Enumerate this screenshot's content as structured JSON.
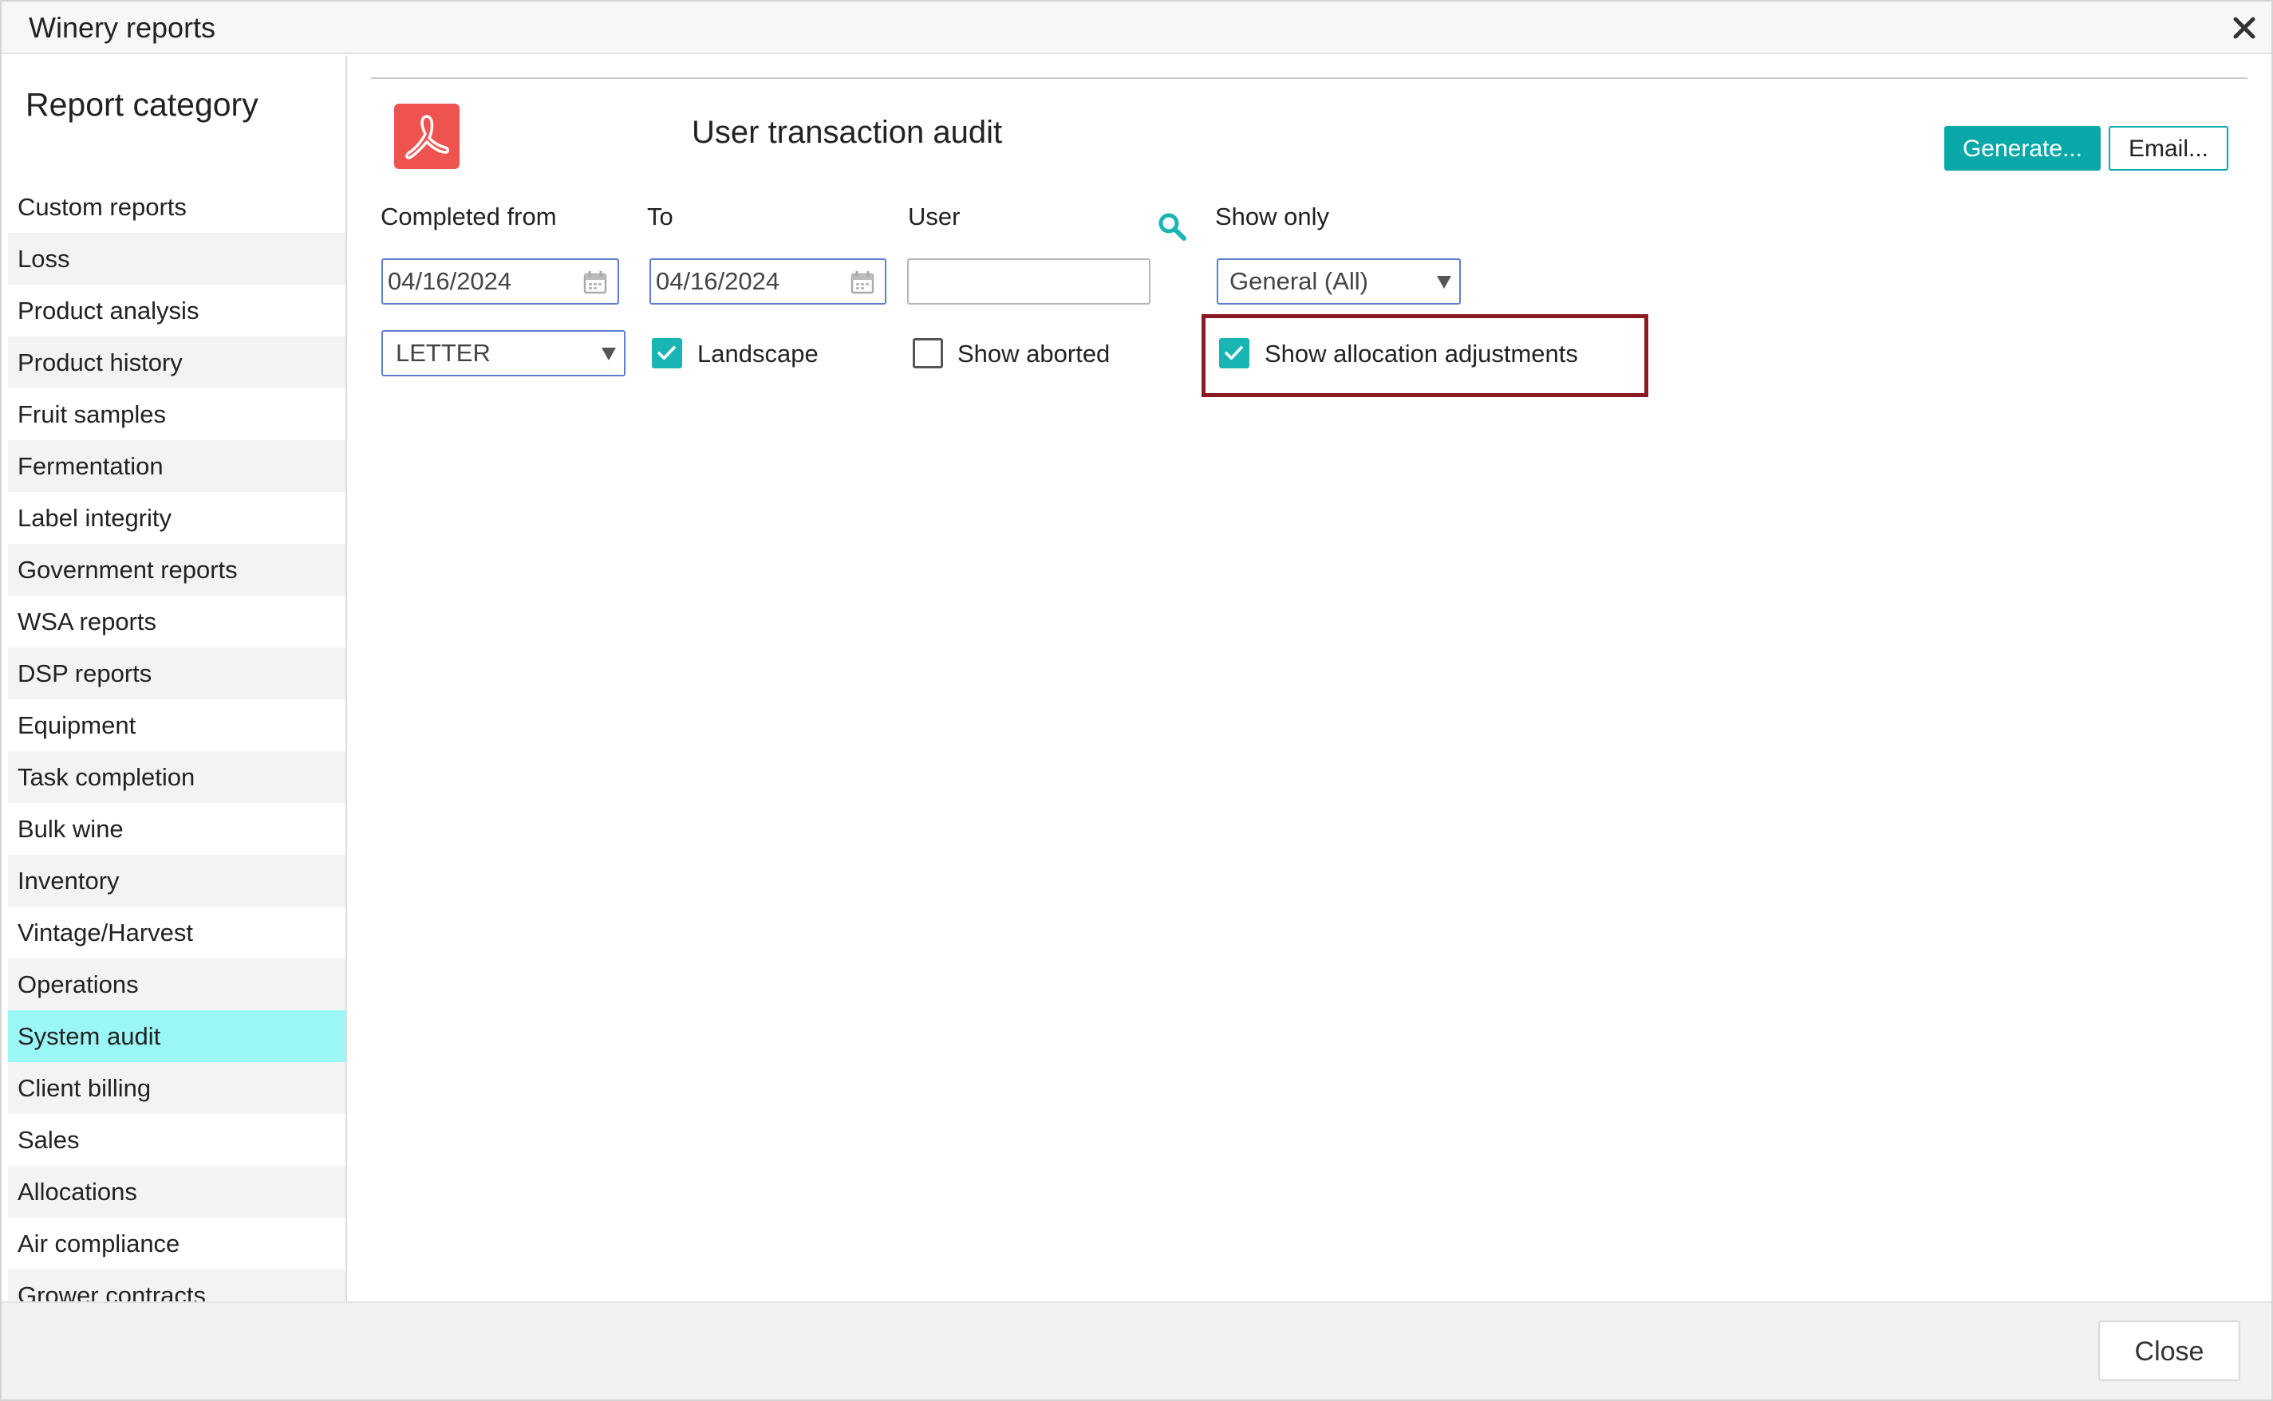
{
  "window": {
    "title": "Winery reports"
  },
  "sidebar": {
    "heading": "Report category",
    "items": [
      {
        "label": "Custom reports"
      },
      {
        "label": "Loss"
      },
      {
        "label": "Product analysis"
      },
      {
        "label": "Product history"
      },
      {
        "label": "Fruit samples"
      },
      {
        "label": "Fermentation"
      },
      {
        "label": "Label integrity"
      },
      {
        "label": "Government reports"
      },
      {
        "label": "WSA reports"
      },
      {
        "label": "DSP reports"
      },
      {
        "label": "Equipment"
      },
      {
        "label": "Task completion"
      },
      {
        "label": "Bulk wine"
      },
      {
        "label": "Inventory"
      },
      {
        "label": "Vintage/Harvest"
      },
      {
        "label": "Operations"
      },
      {
        "label": "System audit"
      },
      {
        "label": "Client billing"
      },
      {
        "label": "Sales"
      },
      {
        "label": "Allocations"
      },
      {
        "label": "Air compliance"
      },
      {
        "label": "Grower contracts"
      }
    ],
    "selected": "System audit"
  },
  "report": {
    "icon": "pdf-icon",
    "title": "User transaction audit",
    "generate_label": "Generate...",
    "email_label": "Email..."
  },
  "form": {
    "completed_from": {
      "label": "Completed from",
      "value": "04/16/2024"
    },
    "to": {
      "label": "To",
      "value": "04/16/2024"
    },
    "user": {
      "label": "User",
      "value": ""
    },
    "show_only": {
      "label": "Show only",
      "value": "General (All)"
    },
    "paper_size": {
      "value": "LETTER"
    },
    "landscape": {
      "label": "Landscape",
      "checked": true
    },
    "show_aborted": {
      "label": "Show aborted",
      "checked": false
    },
    "show_allocation_adjustments": {
      "label": "Show allocation adjustments",
      "checked": true
    }
  },
  "footer": {
    "close_label": "Close"
  },
  "colors": {
    "accent": "#0aa8a8",
    "selected_row": "#9bf6f6",
    "highlight_border": "#8b1a22",
    "pdf_red": "#ef5350"
  }
}
